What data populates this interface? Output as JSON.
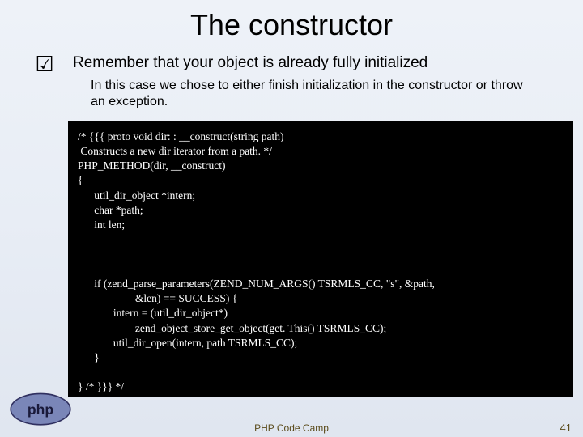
{
  "title": "The constructor",
  "bullet_glyph": "☑",
  "point": {
    "main": "Remember that your object is already fully initialized",
    "sub": "In this case we chose to either finish initialization in the constructor or throw an exception."
  },
  "code": "/* {{{ proto void dir: : __construct(string path)\n Constructs a new dir iterator from a path. */\nPHP_METHOD(dir, __construct)\n{\n      util_dir_object *intern;\n      char *path;\n      int len;\n\n\n\n      if (zend_parse_parameters(ZEND_NUM_ARGS() TSRMLS_CC, \"s\", &path,\n                     &len) == SUCCESS) {\n             intern = (util_dir_object*)\n                     zend_object_store_get_object(get. This() TSRMLS_CC);\n             util_dir_open(intern, path TSRMLS_CC);\n      }\n\n} /* }}} */",
  "footer": {
    "center": "PHP Code Camp",
    "page": "41"
  }
}
